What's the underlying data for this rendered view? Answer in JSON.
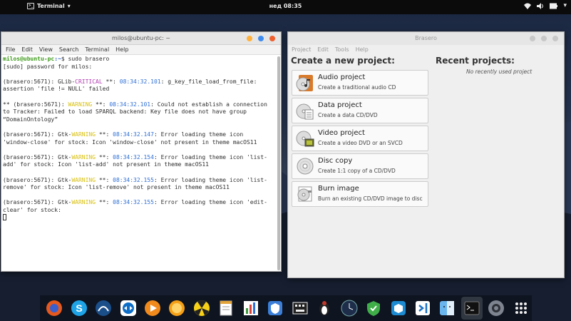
{
  "topbar": {
    "app_name": "Terminal",
    "clock": "нед 08:35",
    "tray_icons": [
      "wifi-icon",
      "volume-icon",
      "battery-icon",
      "dropdown-icon"
    ]
  },
  "terminal": {
    "title": "milos@ubuntu-pc: ~",
    "menu": [
      "File",
      "Edit",
      "View",
      "Search",
      "Terminal",
      "Help"
    ],
    "prompt_user": "milos@ubuntu-pc",
    "prompt_path": ":~$ sudo brasero",
    "sudo_line": "[sudo] password for milos:",
    "lines": [
      {
        "prefix": "(brasero:5671): GLib-",
        "level": "CRITICAL",
        "mid": " **: ",
        "time": "08:34:32.101",
        "text": ": g_key_file_load_from_file: assertion 'file != NULL' failed"
      },
      {
        "prefix": "** (brasero:5671): ",
        "level": "WARNING",
        "mid": " **: ",
        "time": "08:34:32.101",
        "text": ": Could not establish a connection to Tracker: Failed to load SPARQL backend: Key file does not have group “DomainOntology”"
      },
      {
        "prefix": "(brasero:5671): Gtk-",
        "level": "WARNING",
        "mid": " **: ",
        "time": "08:34:32.147",
        "text": ": Error loading theme icon 'window-close' for stock: Icon 'window-close' not present in theme macOS11"
      },
      {
        "prefix": "(brasero:5671): Gtk-",
        "level": "WARNING",
        "mid": " **: ",
        "time": "08:34:32.154",
        "text": ": Error loading theme icon 'list-add' for stock: Icon 'list-add' not present in theme macOS11"
      },
      {
        "prefix": "(brasero:5671): Gtk-",
        "level": "WARNING",
        "mid": " **: ",
        "time": "08:34:32.155",
        "text": ": Error loading theme icon 'list-remove' for stock: Icon 'list-remove' not present in theme macOS11"
      },
      {
        "prefix": "(brasero:5671): Gtk-",
        "level": "WARNING",
        "mid": " **: ",
        "time": "08:34:32.155",
        "text": ": Error loading theme icon 'edit-clear' for stock:"
      }
    ]
  },
  "brasero": {
    "title": "Brasero",
    "menu": [
      "Project",
      "Edit",
      "Tools",
      "Help"
    ],
    "new_heading": "Create a new project:",
    "recent_heading": "Recent projects:",
    "recent_empty": "No recently used project",
    "projects": [
      {
        "title": "Audio project",
        "desc": "Create a traditional audio CD",
        "icon": "audio-cd-icon"
      },
      {
        "title": "Data project",
        "desc": "Create a data CD/DVD",
        "icon": "data-disc-icon"
      },
      {
        "title": "Video project",
        "desc": "Create a video DVD or an SVCD",
        "icon": "video-disc-icon"
      },
      {
        "title": "Disc copy",
        "desc": "Create 1:1 copy of a CD/DVD",
        "icon": "disc-copy-icon"
      },
      {
        "title": "Burn image",
        "desc": "Burn an existing CD/DVD image to disc",
        "icon": "burn-image-icon"
      }
    ]
  },
  "dock": {
    "apps": [
      "firefox-icon",
      "skype-icon",
      "browser-icon",
      "teamviewer-icon",
      "media-player-icon",
      "orange-app-icon",
      "radiation-app-icon",
      "text-editor-icon",
      "system-monitor-icon",
      "security-icon",
      "keyboard-icon",
      "penguin-icon",
      "clock-app-icon",
      "shield-icon",
      "package-icon",
      "vscode-icon",
      "finder-icon",
      "terminal-icon",
      "settings-icon",
      "app-grid-icon"
    ]
  },
  "colors": {
    "close": "#f0602f",
    "minimize": "#ffb13b",
    "maximize": "#3f8cf0",
    "prompt_green": "#3d9a1a",
    "prompt_blue": "#2a5fc7",
    "critical": "#b03ab0",
    "warning": "#d8c010",
    "timestamp": "#2f6fd6"
  }
}
